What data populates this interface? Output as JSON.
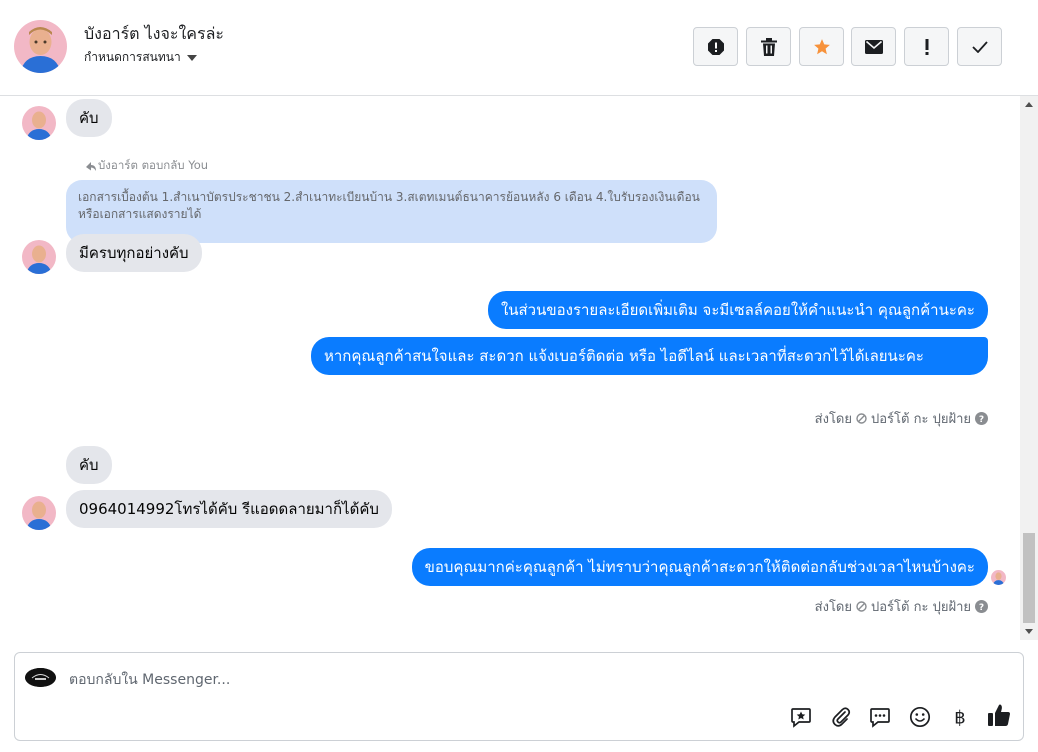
{
  "header": {
    "contact_name": "บังอาร์ต ไงจะใครล่ะ",
    "assign_label": "กำหนดการสนทนา",
    "actions": [
      {
        "name": "report-spam-icon"
      },
      {
        "name": "trash-icon"
      },
      {
        "name": "star-icon"
      },
      {
        "name": "mail-icon"
      },
      {
        "name": "important-icon"
      },
      {
        "name": "check-icon"
      }
    ]
  },
  "thread": {
    "m1": "คับ",
    "reply_hint": "บังอาร์ต ตอบกลับ You",
    "quoted": "เอกสารเบื้องต้น 1.สำเนาบัตรประชาชน 2.สำเนาทะเบียนบ้าน 3.สเตทเมนต์ธนาคารย้อนหลัง 6 เดือน 4.ใบรับรองเงินเดือนหรือเอกสารแสดงรายได้",
    "m2": "มีครบทุกอย่างคับ",
    "m3": "ในส่วนของรายละเอียดเพิ่มเติม จะมีเซลล์คอยให้คำแนะนำ คุณลูกค้านะคะ",
    "m4": "หากคุณลูกค้าสนใจและ สะดวก แจ้งเบอร์ติดต่อ หรือ ไอดีไลน์ และเวลาที่สะดวกไว้ได้เลยนะคะ",
    "sent_by_label": "ส่งโดย",
    "sender_name": "ปอร์โต้ กะ ปุยฝ้าย",
    "m5": "คับ",
    "m6": "0964014992โทรได้คับ รีแอดดลายมาก็ได้คับ",
    "m7": "ขอบคุณมากค่ะคุณลูกค้า ไม่ทราบว่าคุณลูกค้าสะดวกให้ติดต่อกลับช่วงเวลาไหนบ้างคะ"
  },
  "composer": {
    "placeholder": "ตอบกลับใน Messenger...",
    "icons": [
      "saved-reply-icon",
      "attachment-icon",
      "chat-bubble-icon",
      "emoji-icon",
      "baht-icon",
      "thumbs-up-icon"
    ]
  },
  "colors": {
    "outgoing_bubble": "#0a7cff",
    "incoming_bubble": "#e4e6eb",
    "quoted_bubble": "#cfe0fa",
    "star": "#f7923b"
  }
}
